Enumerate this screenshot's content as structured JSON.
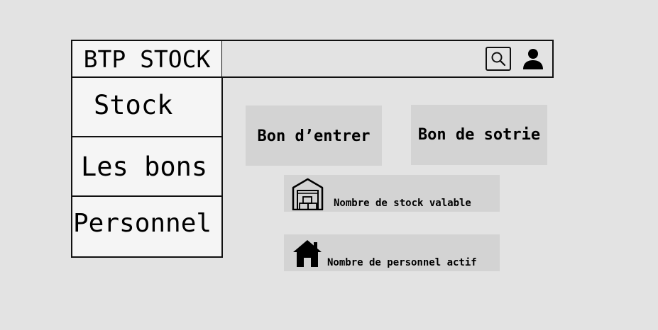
{
  "app": {
    "title": "BTP STOCK"
  },
  "sidebar": {
    "items": [
      {
        "label": "Stock"
      },
      {
        "label": "Les bons"
      },
      {
        "label": "Personnel"
      }
    ]
  },
  "header": {
    "icons": [
      "search-icon",
      "user-icon"
    ]
  },
  "actions": {
    "bon_entrer": "Bon d’entrer",
    "bon_sortie": "Bon de sotrie"
  },
  "cards": {
    "stock": {
      "label": "Nombre de stock valable",
      "icon": "warehouse-icon"
    },
    "personnel": {
      "label": "Nombre de personnel actif",
      "icon": "house-icon"
    }
  },
  "colors": {
    "background": "#e3e3e3",
    "panel": "#f5f5f5",
    "button": "#d3d3d3",
    "border": "#111111"
  }
}
